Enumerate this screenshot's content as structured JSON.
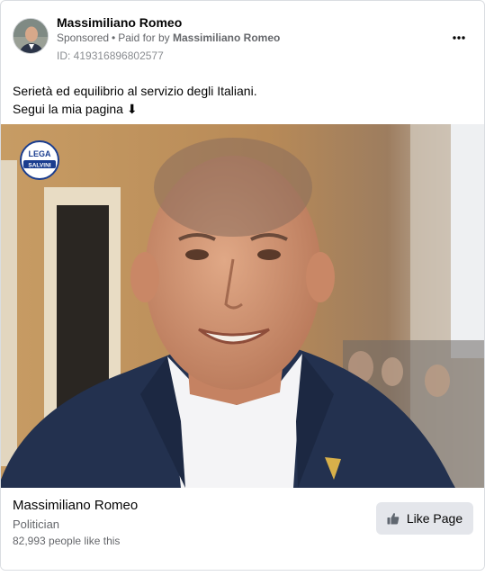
{
  "ad": {
    "advertiser_name": "Massimiliano Romeo",
    "sponsored_label": "Sponsored",
    "separator": "•",
    "paid_for_prefix": "Paid for by",
    "payer_name": "Massimiliano Romeo",
    "ad_id": "ID: 419316896802577",
    "more_icon": "more-horizontal-icon",
    "body_lines": [
      "Serietà ed equilibrio al servizio degli Italiani.",
      "Segui la mia pagina ⬇"
    ],
    "image": {
      "logo_text_top": "LEGA",
      "logo_text_bottom": "SALVINI",
      "logo_colors": {
        "blue": "#1a3d8f",
        "white": "#ffffff"
      }
    }
  },
  "footer": {
    "page_name": "Massimiliano Romeo",
    "category": "Politician",
    "likes_text": "82,993 people like this",
    "like_button_label": "Like Page",
    "like_icon": "thumbs-up-icon"
  },
  "colors": {
    "secondary_text": "#65676b",
    "button_bg": "#e4e6eb",
    "border": "#dadde1"
  }
}
